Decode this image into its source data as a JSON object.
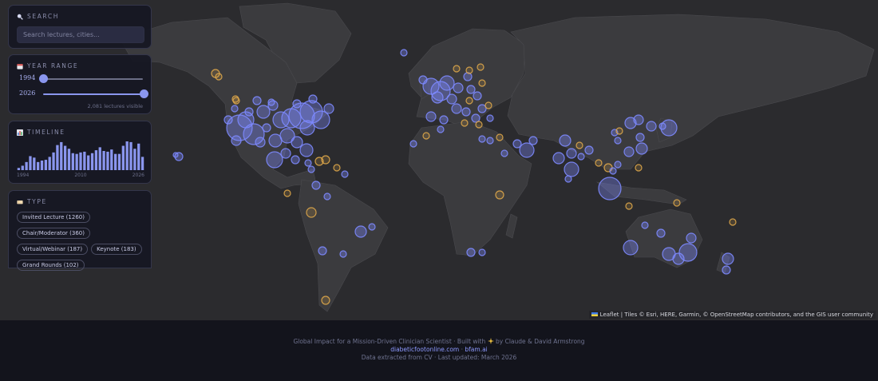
{
  "search": {
    "heading": "Search",
    "placeholder": "Search lectures, cities..."
  },
  "year_range": {
    "heading": "Year Range",
    "start": "1994",
    "end": "2026",
    "start_fraction": 0.0,
    "end_fraction": 1.0,
    "visible_count": "2,081 lectures visible"
  },
  "timeline": {
    "heading": "Timeline",
    "chart_data": {
      "type": "bar",
      "x": [
        1994,
        1995,
        1996,
        1997,
        1998,
        1999,
        2000,
        2001,
        2002,
        2003,
        2004,
        2005,
        2006,
        2007,
        2008,
        2009,
        2010,
        2011,
        2012,
        2013,
        2014,
        2015,
        2016,
        2017,
        2018,
        2019,
        2020,
        2021,
        2022,
        2023,
        2024,
        2025,
        2026
      ],
      "values": [
        6,
        12,
        22,
        38,
        34,
        22,
        26,
        28,
        36,
        48,
        68,
        76,
        66,
        58,
        46,
        44,
        48,
        50,
        40,
        46,
        54,
        62,
        52,
        50,
        56,
        44,
        44,
        66,
        78,
        76,
        58,
        72,
        36
      ],
      "tick_labels": [
        "1994",
        "2010",
        "2026"
      ],
      "color": "#8a96ee"
    }
  },
  "type_filter": {
    "heading": "Type",
    "chips": [
      "Invited Lecture (1260)",
      "Chair/Moderator (360)",
      "Virtual/Webinar (187)",
      "Keynote (183)",
      "Grand Rounds (102)"
    ]
  },
  "map": {
    "attribution": "Leaflet | Tiles © Esri, HERE, Garmin, © OpenStreetMap contributors, and the GIS user community"
  },
  "footer": {
    "line1": "Global Impact for a Mission-Driven Clinician Scientist · Built with",
    "line1_tail": "by Claude & David Armstrong",
    "link1": "diabeticfootonline.com",
    "separator": " · ",
    "link2": "bfam.ai",
    "line3": "Data extracted from CV · Last updated: March 2026"
  },
  "colors": {
    "lecture_marker": "#7d89ff",
    "keynote_marker": "#e0a84a",
    "land": "#3a3a3d",
    "ocean": "#2b2b2e"
  }
}
